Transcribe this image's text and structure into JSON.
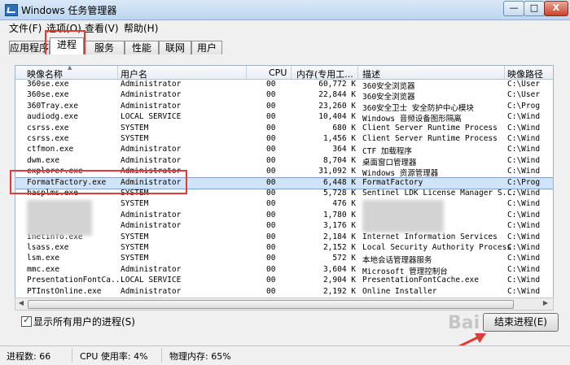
{
  "window": {
    "title": "Windows 任务管理器",
    "min": "—",
    "max": "□",
    "close": "X"
  },
  "menu": [
    "文件(F)",
    "选项(O)",
    "查看(V)",
    "帮助(H)"
  ],
  "tabs": [
    "应用程序",
    "进程",
    "服务",
    "性能",
    "联网",
    "用户"
  ],
  "columns": [
    "映像名称",
    "用户名",
    "CPU",
    "内存(专用工...",
    "描述",
    "映像路径"
  ],
  "rows": [
    [
      "360se.exe",
      "Administrator",
      "00",
      "60,772 K",
      "360安全浏览器",
      "C:\\User"
    ],
    [
      "360se.exe",
      "Administrator",
      "00",
      "22,844 K",
      "360安全浏览器",
      "C:\\User"
    ],
    [
      "360Tray.exe",
      "Administrator",
      "00",
      "23,260 K",
      "360安全卫士 安全防护中心模块",
      "C:\\Prog"
    ],
    [
      "audiodg.exe",
      "LOCAL SERVICE",
      "00",
      "10,404 K",
      "Windows 音频设备图形隔离",
      "C:\\Wind"
    ],
    [
      "csrss.exe",
      "SYSTEM",
      "00",
      "680 K",
      "Client Server Runtime Process",
      "C:\\Wind"
    ],
    [
      "csrss.exe",
      "SYSTEM",
      "00",
      "1,456 K",
      "Client Server Runtime Process",
      "C:\\Wind"
    ],
    [
      "ctfmon.exe",
      "Administrator",
      "00",
      "364 K",
      "CTF 加载程序",
      "C:\\Wind"
    ],
    [
      "dwm.exe",
      "Administrator",
      "00",
      "8,704 K",
      "桌面窗口管理器",
      "C:\\Wind"
    ],
    [
      "explorer.exe",
      "Administrator",
      "00",
      "31,092 K",
      "Windows 资源管理器",
      "C:\\Wind"
    ],
    [
      "FormatFactory.exe",
      "Administrator",
      "00",
      "6,448 K",
      "FormatFactory",
      "C:\\Prog"
    ],
    [
      "hasplms.exe",
      "SYSTEM",
      "00",
      "5,728 K",
      "Sentinel LDK License Manager S...",
      "C:\\Wind"
    ],
    [
      "",
      "SYSTEM",
      "00",
      "476 K",
      "",
      "C:\\Wind"
    ],
    [
      "",
      "Administrator",
      "00",
      "1,780 K",
      "",
      "C:\\Wind"
    ],
    [
      "",
      "Administrator",
      "00",
      "3,176 K",
      "",
      "C:\\Wind"
    ],
    [
      "inetinfo.exe",
      "SYSTEM",
      "00",
      "2,184 K",
      "Internet Information Services",
      "C:\\Wind"
    ],
    [
      "lsass.exe",
      "SYSTEM",
      "00",
      "2,152 K",
      "Local Security Authority Process",
      "C:\\Wind"
    ],
    [
      "lsm.exe",
      "SYSTEM",
      "00",
      "572 K",
      "本地会话管理器服务",
      "C:\\Wind"
    ],
    [
      "mmc.exe",
      "Administrator",
      "00",
      "3,604 K",
      "Microsoft 管理控制台",
      "C:\\Wind"
    ],
    [
      "PresentationFontCa...",
      "LOCAL SERVICE",
      "00",
      "2,904 K",
      "PresentationFontCache.exe",
      "C:\\Wind"
    ],
    [
      "PTInstOnline.exe",
      "Administrator",
      "00",
      "2,192 K",
      "Online Installer",
      "C:\\Wind"
    ]
  ],
  "show_all": "显示所有用户的进程(S)",
  "end_process": "结束进程(E)",
  "status": {
    "processes": "进程数: 66",
    "cpu": "CPU 使用率: 4%",
    "memory": "物理内存: 65%"
  },
  "watermark": "Bai"
}
